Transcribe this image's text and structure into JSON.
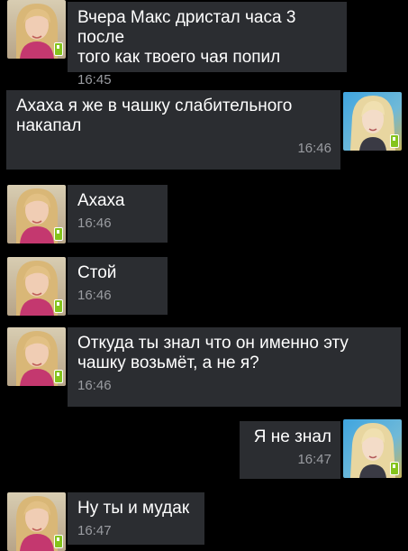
{
  "conversation": {
    "messages": [
      {
        "sender": "them",
        "text": "Вчера Макс дристал часа 3 после\nтого как твоего чая попил",
        "time": "16:45"
      },
      {
        "sender": "me",
        "text": "Ахаха я же в чашку слабительного\nнакапал",
        "time": "16:46"
      },
      {
        "sender": "them",
        "text": "Ахаха",
        "time": "16:46"
      },
      {
        "sender": "them",
        "text": "Стой",
        "time": "16:46"
      },
      {
        "sender": "them",
        "text": "Откуда ты знал что он именно эту\nчашку возьмёт, а не я?",
        "time": "16:46"
      },
      {
        "sender": "me",
        "text": "Я не знал",
        "time": "16:47"
      },
      {
        "sender": "them",
        "text": "Ну ты и мудак",
        "time": "16:47"
      }
    ]
  },
  "theme": {
    "background": "#000000",
    "bubble": "#2b2d31",
    "text": "#ffffff",
    "timestamp": "#9a9ca1",
    "online_badge": "#84c41c"
  },
  "icons": {
    "contact_avatar": "avatar-blonde-woman-pink",
    "own_avatar": "avatar-blonde-woman-blue",
    "mobile_status": "mobile-phone-icon"
  }
}
